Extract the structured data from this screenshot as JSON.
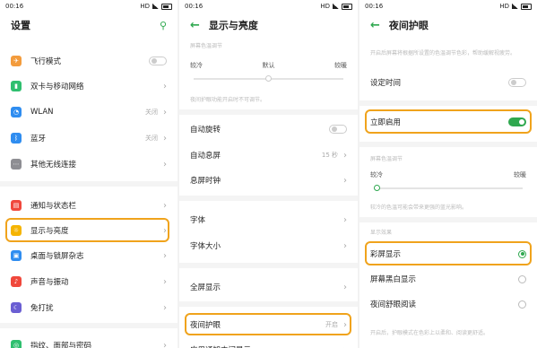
{
  "status": {
    "time": "00:16",
    "hp": "HD"
  },
  "panel1": {
    "title": "设置",
    "items": [
      {
        "label": "飞行模式",
        "icon": "airplane-icon",
        "color": "#f39c3d",
        "glyph": "✈",
        "control": "switch"
      },
      {
        "label": "双卡与移动网络",
        "icon": "sim-icon",
        "color": "#2fbf6f",
        "glyph": "▮",
        "control": "chev"
      },
      {
        "label": "WLAN",
        "icon": "wifi-icon",
        "color": "#2f8df0",
        "glyph": "◔",
        "value": "关闭",
        "control": "chev"
      },
      {
        "label": "蓝牙",
        "icon": "bluetooth-icon",
        "color": "#2f8df0",
        "glyph": "ᛒ",
        "value": "关闭",
        "control": "chev"
      },
      {
        "label": "其他无线连接",
        "icon": "more-connections-icon",
        "color": "#8e8e93",
        "glyph": "⋯",
        "control": "chev"
      },
      {
        "label": "通知与状态栏",
        "icon": "notification-icon",
        "color": "#f0483c",
        "glyph": "▤",
        "control": "chev"
      },
      {
        "label": "显示与亮度",
        "icon": "brightness-icon",
        "color": "#f5b400",
        "glyph": "☼",
        "control": "chev"
      },
      {
        "label": "桌面与锁屏杂志",
        "icon": "wallpaper-icon",
        "color": "#2f8df0",
        "glyph": "▣",
        "control": "chev"
      },
      {
        "label": "声音与振动",
        "icon": "sound-icon",
        "color": "#f0483c",
        "glyph": "♪",
        "control": "chev"
      },
      {
        "label": "免打扰",
        "icon": "moon-icon",
        "color": "#6b5fd3",
        "glyph": "☾",
        "control": "chev"
      },
      {
        "label": "指纹、面部与密码",
        "icon": "fingerprint-icon",
        "color": "#2fbf6f",
        "glyph": "◎",
        "control": "chev"
      }
    ]
  },
  "panel2": {
    "title": "显示与亮度",
    "temp_caption": "屏幕色温调节",
    "temp_labels": [
      "较冷",
      "默认",
      "较暖"
    ],
    "temp_note": "夜间护眼功能开启时不可调节。",
    "items": [
      {
        "label": "自动旋转",
        "control": "switch"
      },
      {
        "label": "自动息屏",
        "value": "15 秒",
        "control": "chev"
      },
      {
        "label": "息屏时钟",
        "control": "chev"
      },
      {
        "label": "字体",
        "control": "chev"
      },
      {
        "label": "字体大小",
        "control": "chev"
      },
      {
        "label": "全屏显示",
        "control": "chev"
      },
      {
        "label": "夜间护眼",
        "value": "开启",
        "control": "chev"
      },
      {
        "label": "应用通知中间显示",
        "control": "chev"
      }
    ]
  },
  "panel3": {
    "title": "夜间护眼",
    "note_top": "开启后屏幕将根据所设置的色温调节色彩，帮助缓解视疲劳。",
    "schedule_label": "设定时间",
    "now_label": "立即启用",
    "temp_caption": "屏幕色温调节",
    "temp_labels": [
      "较冷",
      "较暖"
    ],
    "temp_note": "较冷的色温可能会带来更强的蓝光影响。",
    "mode_caption": "显示效果",
    "modes": [
      {
        "label": "彩屏显示",
        "selected": true
      },
      {
        "label": "屏幕黑白显示",
        "selected": false
      },
      {
        "label": "夜间舒眼阅读",
        "selected": false
      }
    ],
    "note_bottom": "开启后，护眼模式在色彩上以柔和、阅读更舒适。"
  }
}
